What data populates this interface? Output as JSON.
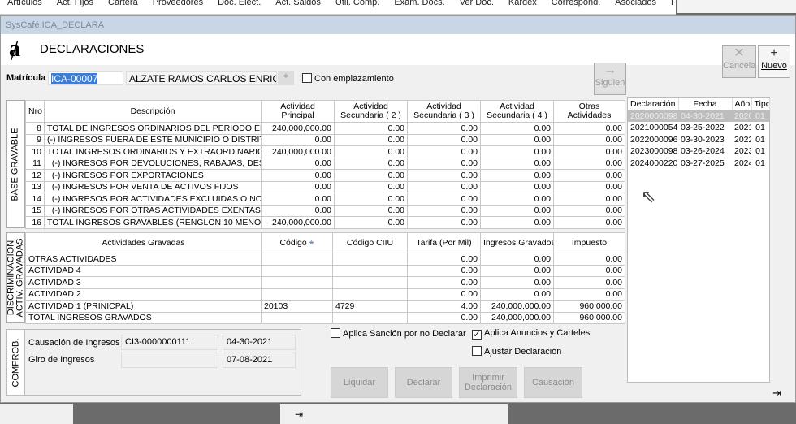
{
  "menu": [
    "Artículos",
    "Act. Fijos",
    "Cartera",
    "Proveedores",
    "Doc. Elect.",
    "Act. Saldos",
    "Util. Comp.",
    "Exam. Docs.",
    "Ver Doc.",
    "Kardex",
    "Correspond.",
    "Asociados",
    "Favoritos"
  ],
  "window_title": "SysCafé.ICA_DECLARA",
  "page_title": "DECLARACIONES",
  "toolbar": {
    "cancel": "Cancela",
    "new": "Nuevo",
    "next": "Siguien"
  },
  "matricula": {
    "label": "Matrícula",
    "code": "ICA-00007",
    "name": "ALZATE RAMOS CARLOS ENRIQUE",
    "emplazamiento": "Con emplazamiento"
  },
  "base": {
    "label": "BASE GRAVABLE",
    "headers": [
      "Nro",
      "Descripción",
      "Actividad Principal",
      "Actividad Secundaria ( 2 )",
      "Actividad Secundaria ( 3 )",
      "Actividad Secundaria ( 4 )",
      "Otras Actividades"
    ],
    "rows": [
      [
        "8",
        "TOTAL DE INGRESOS ORDINARIOS DEL PERIODO EN TODO EL PAIS",
        "240,000,000.00",
        "0.00",
        "0.00",
        "0.00",
        "0.00"
      ],
      [
        "9",
        "(-) INGRESOS FUERA DE ESTE MUNICIPIO O DISTRITO",
        "0.00",
        "0.00",
        "0.00",
        "0.00",
        "0.00"
      ],
      [
        "10",
        "TOTAL INGRESOS ORDINARIOS Y EXTRAORDINARIOS EN EL MUNICIPIO",
        "240,000,000.00",
        "0.00",
        "0.00",
        "0.00",
        "0.00"
      ],
      [
        "11",
        "  (-) INGRESOS POR DEVOLUCIONES, RABAJAS, DESCUENTOS",
        "0.00",
        "0.00",
        "0.00",
        "0.00",
        "0.00"
      ],
      [
        "12",
        "  (-) INGRESOS POR EXPORTACIONES",
        "0.00",
        "0.00",
        "0.00",
        "0.00",
        "0.00"
      ],
      [
        "13",
        "  (-) INGRESOS POR VENTA DE ACTIVOS FIJOS",
        "0.00",
        "0.00",
        "0.00",
        "0.00",
        "0.00"
      ],
      [
        "14",
        "  (-) INGRESOS POR ACTIVIDADES EXCLUIDAS O NO SUJETAS",
        "0.00",
        "0.00",
        "0.00",
        "0.00",
        "0.00"
      ],
      [
        "15",
        "  (-) INGRESOS POR OTRAS ACTIVIDADES EXENTAS EN ESTE MUNICIPIO",
        "0.00",
        "0.00",
        "0.00",
        "0.00",
        "0.00"
      ],
      [
        "16",
        "TOTAL INGRESOS GRAVABLES (RENGLON 10 MENOS 11,12,13,14 Y 15)",
        "240,000,000.00",
        "0.00",
        "0.00",
        "0.00",
        "0.00"
      ]
    ]
  },
  "disc": {
    "label1": "DISCRIMINACION",
    "label2": "ACTIV. GRAVADAS",
    "headers": [
      "Actividades Gravadas",
      "Código",
      "Código CIIU",
      "Tarifa (Por Mil)",
      "Ingresos Gravados",
      "Impuesto"
    ],
    "rows": [
      [
        "OTRAS ACTIVIDADES",
        "",
        "",
        "0.00",
        "0.00",
        "0.00"
      ],
      [
        "ACTIVIDAD 4",
        "",
        "",
        "0.00",
        "0.00",
        "0.00"
      ],
      [
        "ACTIVIDAD 3",
        "",
        "",
        "0.00",
        "0.00",
        "0.00"
      ],
      [
        "ACTIVIDAD 2",
        "",
        "",
        "0.00",
        "0.00",
        "0.00"
      ],
      [
        "ACTIVIDAD 1 (PRINICPAL)",
        "20103",
        "4729",
        "4.00",
        "240,000,000.00",
        "960,000.00"
      ],
      [
        "TOTAL INGRESOS GRAVADOS",
        "",
        "",
        "0.00",
        "240,000,000.00",
        "960,000.00"
      ]
    ]
  },
  "declaraciones": {
    "headers": [
      "Declaración",
      "Fecha",
      "Año",
      "Tipo"
    ],
    "rows": [
      [
        "2020000098",
        "04-30-2021",
        "2020",
        "01"
      ],
      [
        "2021000054",
        "03-25-2022",
        "2021",
        "01"
      ],
      [
        "2022000096",
        "03-30-2023",
        "2022",
        "01"
      ],
      [
        "2023000098",
        "03-26-2024",
        "2023",
        "01"
      ],
      [
        "2024000220",
        "03-27-2025",
        "2024",
        "01"
      ]
    ]
  },
  "comprob": {
    "label": "COMPROB.",
    "causacion_label": "Causación de Ingresos",
    "causacion_code": "CI3-0000000111",
    "causacion_date": "04-30-2021",
    "giro_label": "Giro de Ingresos",
    "giro_code": "",
    "giro_date": "07-08-2021"
  },
  "options": {
    "sancion": "Aplica Sanción por no Declarar",
    "sancion_checked": false,
    "anuncios": "Aplica Anuncios y Carteles",
    "anuncios_checked": true,
    "ajustar": "Ajustar Declaración",
    "ajustar_checked": false
  },
  "actions": {
    "liquidar": "Liquidar",
    "declarar": "Declarar",
    "imprimir1": "Imprimir",
    "imprimir2": "Declaración",
    "causacion": "Causación"
  }
}
